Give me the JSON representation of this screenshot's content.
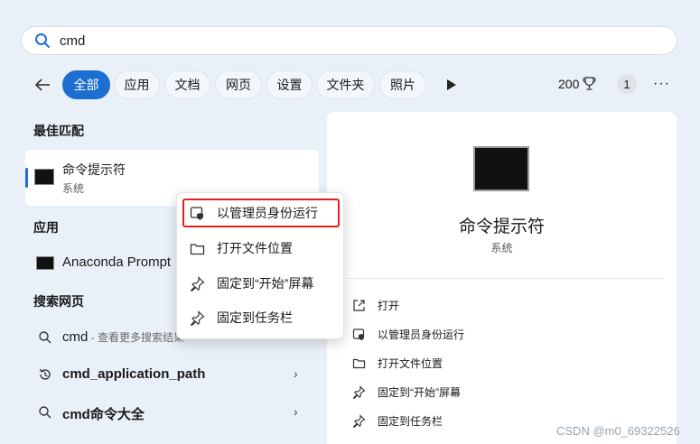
{
  "search": {
    "query": "cmd"
  },
  "tabs": [
    {
      "label": "全部",
      "active": true
    },
    {
      "label": "应用"
    },
    {
      "label": "文档"
    },
    {
      "label": "网页"
    },
    {
      "label": "设置"
    },
    {
      "label": "文件夹"
    },
    {
      "label": "照片"
    }
  ],
  "toolbar": {
    "points": "200",
    "notification_count": "1",
    "more": "···"
  },
  "best_match": {
    "heading": "最佳匹配",
    "title": "命令提示符",
    "subtitle": "系统"
  },
  "apps": {
    "heading": "应用",
    "items": [
      {
        "label": "Anaconda Prompt"
      }
    ]
  },
  "web": {
    "heading": "搜索网页",
    "items": [
      {
        "label": "cmd",
        "hint": " - 查看更多搜索结果"
      },
      {
        "label": "cmd_application_path"
      },
      {
        "label": "cmd命令大全"
      }
    ]
  },
  "detail": {
    "title": "命令提示符",
    "subtitle": "系统",
    "actions": [
      {
        "label": "打开",
        "icon": "open-icon"
      },
      {
        "label": "以管理员身份运行",
        "icon": "shield-icon"
      },
      {
        "label": "打开文件位置",
        "icon": "folder-icon"
      },
      {
        "label": "固定到“开始”屏幕",
        "icon": "pin-icon"
      },
      {
        "label": "固定到任务栏",
        "icon": "pin-icon"
      }
    ]
  },
  "context_menu": {
    "items": [
      {
        "label": "以管理员身份运行",
        "icon": "shield-icon"
      },
      {
        "label": "打开文件位置",
        "icon": "folder-icon"
      },
      {
        "label": "固定到“开始”屏幕",
        "icon": "pin-icon"
      },
      {
        "label": "固定到任务栏",
        "icon": "pin-icon"
      }
    ]
  },
  "watermark": "CSDN @m0_69322526",
  "colors": {
    "accent": "#1c6fd1",
    "highlight": "#e02020",
    "background": "#eaf0f8"
  }
}
